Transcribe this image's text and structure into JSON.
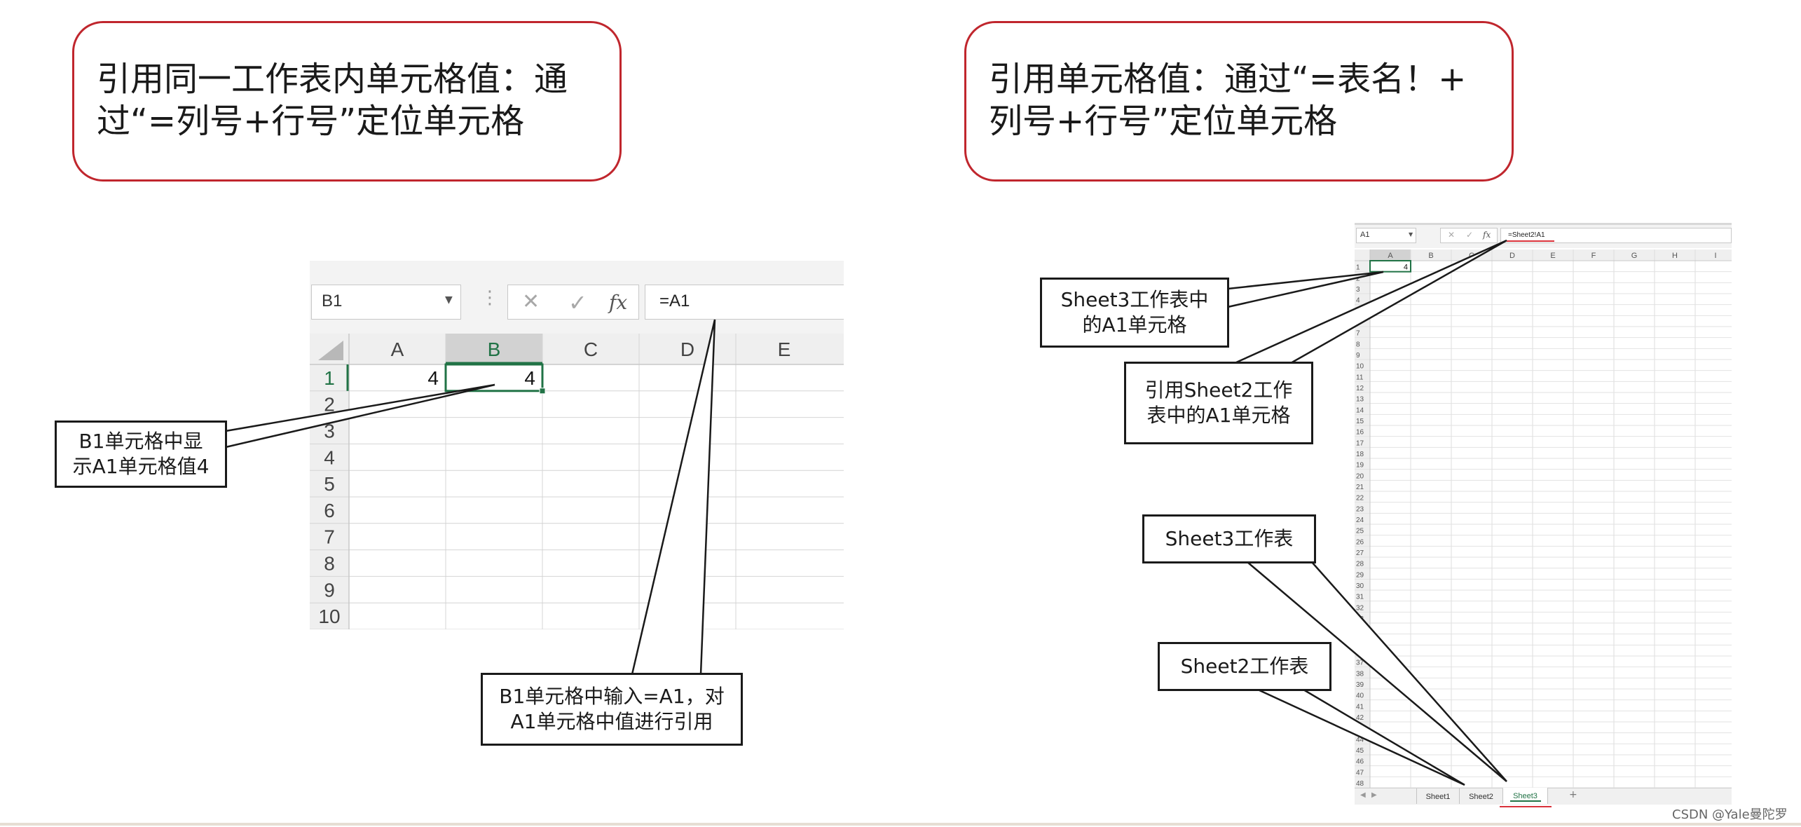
{
  "titles": {
    "left": "引用同一工作表内单元格值：通\n过“=列号+行号”定位单元格",
    "right": "引用单元格值：通过“=表名！+\n列号+行号”定位单元格"
  },
  "left_excel": {
    "name_box": "B1",
    "formula": "=A1",
    "cancel_glyph": "✕",
    "check_glyph": "✓",
    "fx_label": "fx",
    "columns": [
      "A",
      "B",
      "C",
      "D",
      "E"
    ],
    "rows": [
      "1",
      "2",
      "3",
      "4",
      "5",
      "6",
      "7",
      "8",
      "9",
      "10"
    ],
    "cell_a1": "4",
    "cell_b1": "4",
    "selected_color": "#217346"
  },
  "right_excel": {
    "name_box": "A1",
    "formula": "=Sheet2!A1",
    "fx_label": "fx",
    "columns": [
      "A",
      "B",
      "C",
      "D",
      "E",
      "F",
      "G",
      "H",
      "I"
    ],
    "row_count": 48,
    "cell_a1": "4",
    "tabs": [
      "Sheet1",
      "Sheet2",
      "Sheet3"
    ],
    "active_tab": "Sheet3",
    "add_sheet": "+"
  },
  "callouts": {
    "b1_display": "B1单元格中显\n示A1单元格值4",
    "b1_input": "B1单元格中输入=A1，对\nA1单元格中值进行引用",
    "sheet3_a1": "Sheet3工作表中\n的A1单元格",
    "ref_sheet2": "引用Sheet2工作\n表中的A1单元格",
    "sheet3_tab": "Sheet3工作表",
    "sheet2_tab": "Sheet2工作表"
  },
  "watermark": "CSDN @Yale曼陀罗"
}
